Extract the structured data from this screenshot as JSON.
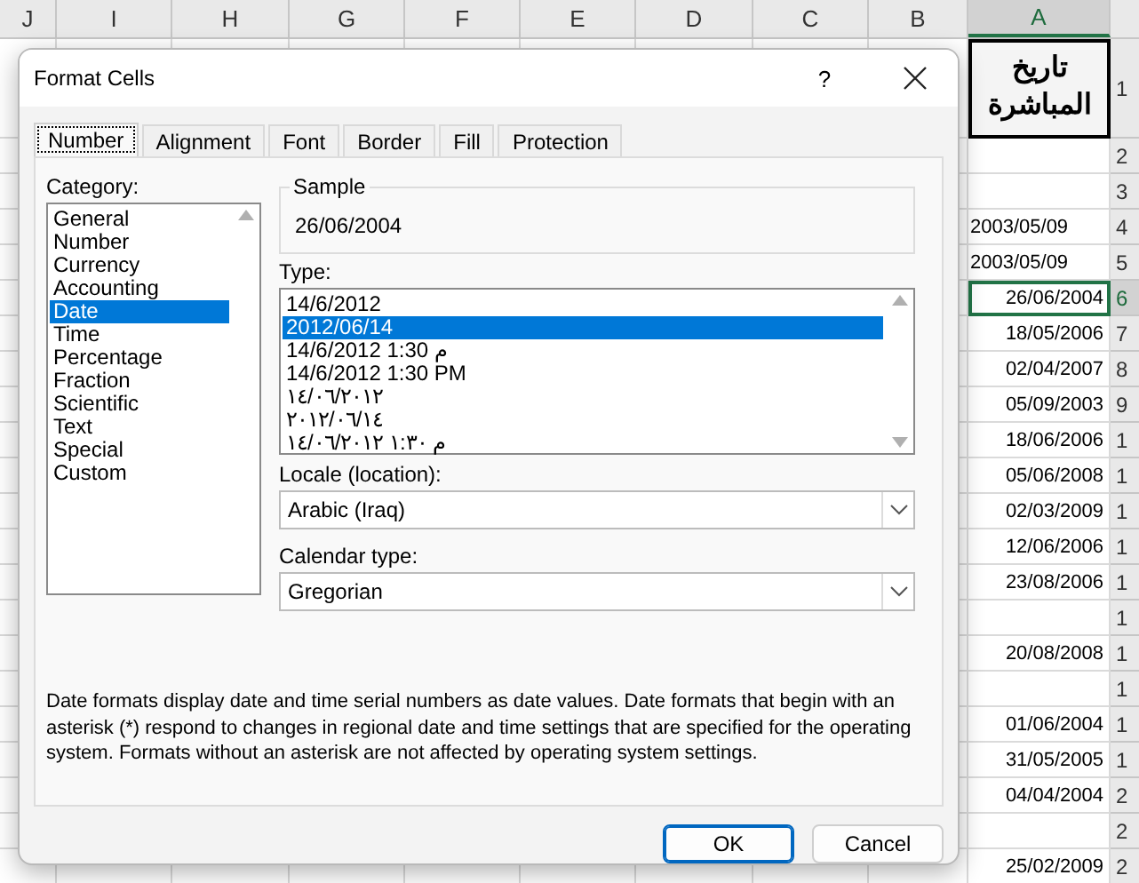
{
  "spreadsheet": {
    "column_headers": [
      {
        "label": "J",
        "selected": false
      },
      {
        "label": "I",
        "selected": false
      },
      {
        "label": "H",
        "selected": false
      },
      {
        "label": "G",
        "selected": false
      },
      {
        "label": "F",
        "selected": false
      },
      {
        "label": "E",
        "selected": false
      },
      {
        "label": "D",
        "selected": false
      },
      {
        "label": "C",
        "selected": false
      },
      {
        "label": "B",
        "selected": false
      },
      {
        "label": "A",
        "selected": true
      }
    ],
    "rows": [
      {
        "number": "1",
        "kind": "header",
        "value": "تاريخ المباشرة",
        "selected": false
      },
      {
        "number": "2",
        "kind": "empty",
        "selected": false
      },
      {
        "number": "3",
        "kind": "empty",
        "selected": false
      },
      {
        "number": "4",
        "kind": "text",
        "value": "2003/05/09",
        "selected": false
      },
      {
        "number": "5",
        "kind": "text",
        "value": "2003/05/09",
        "selected": false
      },
      {
        "number": "6",
        "kind": "date",
        "value": "26/06/2004",
        "selected": true
      },
      {
        "number": "7",
        "kind": "date",
        "value": "18/05/2006",
        "selected": false
      },
      {
        "number": "8",
        "kind": "date",
        "value": "02/04/2007",
        "selected": false
      },
      {
        "number": "9",
        "kind": "date",
        "value": "05/09/2003",
        "selected": false
      },
      {
        "number": "1",
        "kind": "date",
        "value": "18/06/2006",
        "selected": false
      },
      {
        "number": "1",
        "kind": "date",
        "value": "05/06/2008",
        "selected": false
      },
      {
        "number": "1",
        "kind": "date",
        "value": "02/03/2009",
        "selected": false
      },
      {
        "number": "1",
        "kind": "date",
        "value": "12/06/2006",
        "selected": false
      },
      {
        "number": "1",
        "kind": "date",
        "value": "23/08/2006",
        "selected": false
      },
      {
        "number": "1",
        "kind": "empty",
        "selected": false
      },
      {
        "number": "1",
        "kind": "date",
        "value": "20/08/2008",
        "selected": false
      },
      {
        "number": "1",
        "kind": "empty",
        "selected": false
      },
      {
        "number": "1",
        "kind": "date",
        "value": "01/06/2004",
        "selected": false
      },
      {
        "number": "1",
        "kind": "date",
        "value": "31/05/2005",
        "selected": false
      },
      {
        "number": "2",
        "kind": "date",
        "value": "04/04/2004",
        "selected": false
      },
      {
        "number": "2",
        "kind": "empty",
        "selected": false
      },
      {
        "number": "2",
        "kind": "date",
        "value": "25/02/2009",
        "selected": false
      }
    ]
  },
  "dialog": {
    "title": "Format Cells",
    "help": "?",
    "tabs": [
      {
        "label": "Number",
        "selected": true
      },
      {
        "label": "Alignment",
        "selected": false
      },
      {
        "label": "Font",
        "selected": false
      },
      {
        "label": "Border",
        "selected": false
      },
      {
        "label": "Fill",
        "selected": false
      },
      {
        "label": "Protection",
        "selected": false
      }
    ],
    "category": {
      "label": "Category:",
      "items": [
        {
          "label": "General",
          "selected": false
        },
        {
          "label": "Number",
          "selected": false
        },
        {
          "label": "Currency",
          "selected": false
        },
        {
          "label": "Accounting",
          "selected": false
        },
        {
          "label": "Date",
          "selected": true
        },
        {
          "label": "Time",
          "selected": false
        },
        {
          "label": "Percentage",
          "selected": false
        },
        {
          "label": "Fraction",
          "selected": false
        },
        {
          "label": "Scientific",
          "selected": false
        },
        {
          "label": "Text",
          "selected": false
        },
        {
          "label": "Special",
          "selected": false
        },
        {
          "label": "Custom",
          "selected": false
        }
      ]
    },
    "sample": {
      "label": "Sample",
      "value": "26/06/2004"
    },
    "type": {
      "label": "Type:",
      "items": [
        {
          "label": "14/6/2012",
          "selected": false
        },
        {
          "label": "2012/06/14",
          "selected": true
        },
        {
          "label": "14/6/2012 1:30 م",
          "selected": false
        },
        {
          "label": "14/6/2012 1:30 PM",
          "selected": false
        },
        {
          "label": "١٤/٠٦/٢٠١٢",
          "selected": false
        },
        {
          "label": "٢٠١٢/٠٦/١٤",
          "selected": false
        },
        {
          "label": "١٤/٠٦/٢٠١٢ ١:٣٠ م",
          "selected": false
        }
      ]
    },
    "locale": {
      "label": "Locale (location):",
      "value": "Arabic (Iraq)"
    },
    "calendar": {
      "label": "Calendar type:",
      "value": "Gregorian"
    },
    "description": "Date formats display date and time serial numbers as date values.  Date formats that begin with an asterisk (*) respond to changes in regional date and time settings that are specified for the operating system. Formats without an asterisk are not affected by operating system settings.",
    "buttons": [
      {
        "label": "OK",
        "default": true
      },
      {
        "label": "Cancel",
        "default": false
      }
    ]
  }
}
